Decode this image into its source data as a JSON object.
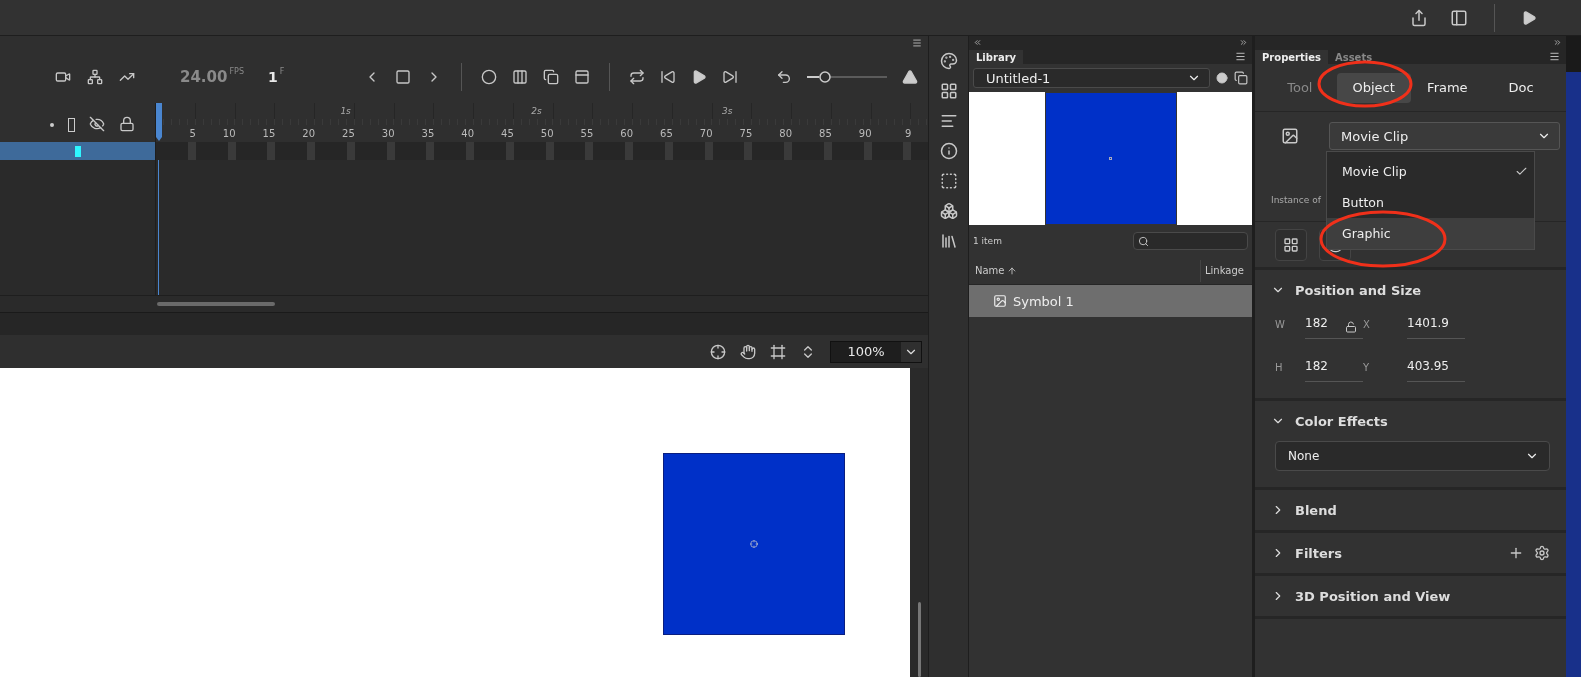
{
  "timeline": {
    "fps": "24.00",
    "fps_unit": "FPS",
    "frame": "1",
    "frame_unit": "F",
    "seconds": [
      "1s",
      "2s",
      "3s"
    ],
    "frame_numbers": [
      "5",
      "10",
      "15",
      "20",
      "25",
      "30",
      "35",
      "40",
      "45",
      "50",
      "55",
      "60",
      "65",
      "70",
      "75",
      "80",
      "85",
      "90",
      "9"
    ],
    "layers": [
      {
        "selected": true
      }
    ],
    "span_slider": {
      "level": 0.2
    }
  },
  "stage": {
    "zoom": "100%"
  },
  "library": {
    "tabs": [
      {
        "label": "Library",
        "selected": true
      }
    ],
    "document": "Untitled-1",
    "item_count": "1 item",
    "columns": [
      "Name",
      "Linkage"
    ],
    "items": [
      {
        "name": "Symbol 1",
        "selected": true
      }
    ]
  },
  "properties": {
    "tabs": [
      {
        "label": "Properties",
        "selected": true
      },
      {
        "label": "Assets",
        "selected": false
      }
    ],
    "modes": [
      {
        "label": "Tool",
        "selected": false,
        "disabled": true,
        "highlighted": false
      },
      {
        "label": "Object",
        "selected": true,
        "disabled": false,
        "highlighted": true
      },
      {
        "label": "Frame",
        "selected": false,
        "disabled": false,
        "highlighted": false
      },
      {
        "label": "Doc",
        "selected": false,
        "disabled": false,
        "highlighted": false
      }
    ],
    "symbol_type": "Movie Clip",
    "instance_label": "Instance of",
    "symbol_menu": [
      {
        "label": "Movie Clip",
        "checked": true,
        "hovered": false,
        "highlighted": false
      },
      {
        "label": "Button",
        "checked": false,
        "hovered": false,
        "highlighted": false
      },
      {
        "label": "Graphic",
        "checked": false,
        "hovered": true,
        "highlighted": true
      }
    ],
    "sections": [
      {
        "kind": "position",
        "title": "Position and Size",
        "expanded": true,
        "fields": [
          {
            "label": "W",
            "value": "182"
          },
          {
            "label": "X",
            "value": "1401.9"
          },
          {
            "label": "H",
            "value": "182"
          },
          {
            "label": "Y",
            "value": "403.95"
          }
        ]
      },
      {
        "kind": "select",
        "title": "Color Effects",
        "expanded": true,
        "value": "None"
      },
      {
        "kind": "plain",
        "title": "Blend",
        "expanded": false
      },
      {
        "kind": "filters",
        "title": "Filters",
        "expanded": false
      },
      {
        "kind": "plain",
        "title": "3D Position and View",
        "expanded": false
      }
    ]
  }
}
